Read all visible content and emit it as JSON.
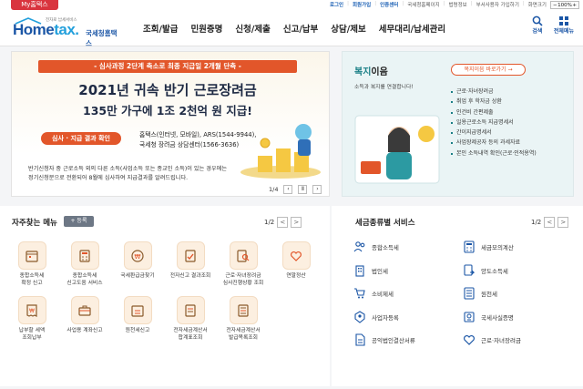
{
  "util": {
    "my_button": "My홈택스",
    "links": [
      "로그인",
      "회원가입",
      "인증센터",
      "국세청홈페이지",
      "법령정보",
      "부서사용자 가입하기",
      "화면크기"
    ],
    "zoom": "100%"
  },
  "header": {
    "logo_tag": "전자로 납세서비스",
    "logo_home": "Home",
    "logo_tax": "tax.",
    "logo_sub": "국세청홈택스",
    "menu": [
      "조회/발급",
      "민원증명",
      "신청/제출",
      "신고/납부",
      "상담/제보",
      "세무대리/납세관리"
    ],
    "search_label": "검색",
    "allmenu_label": "전체메뉴"
  },
  "banner": {
    "pill": "- 심사과정 2단계 축소로 최종 지급일 2개월 단축 -",
    "title": "2021년 귀속 반기 근로장려금",
    "title2": "135만 가구에 1조 2천억 원 지급!",
    "result_button": "심사 · 지급 결과 확인",
    "contact": [
      "홈택스(인터넷, 모바일), ARS(1544-9944),",
      "국세청 장려금 상담센터(1566-3636)"
    ],
    "notice": [
      "반기신청자 중 근로소득 외의 다른 소득(사업소득 또는 종교인 소득)이 있는 경우에는",
      "정기신청분으로 전환되어 8월에 심사하여 지급결과를 알려드립니다."
    ],
    "page": "1/4",
    "prev": "‹",
    "pause": "Ⅱ",
    "next": "›"
  },
  "welfare": {
    "title_accent": "복지",
    "title_rest": "이음",
    "desc": "소득과 복지를 연결합니다!",
    "button": "복지이음 바로가기",
    "arrow": "→",
    "items": [
      "근로·자녀장려금",
      "취업 후 학자금 상환",
      "인건비 간편제출",
      "일용근로소득 지급명세서",
      "간이지급명세서",
      "사업장제공자 등의 과세자료",
      "본인 소득내역 확인(근로·인적용역)"
    ]
  },
  "favorites": {
    "title": "자주찾는 메뉴",
    "register": "+ 등록",
    "page": "1/2",
    "prev": "<",
    "next": ">",
    "items": [
      {
        "label": "종합소득세\n확정 신고",
        "icon": "calendar-icon"
      },
      {
        "label": "종합소득세\n신고도움 서비스",
        "icon": "calculator-icon"
      },
      {
        "label": "국세환급금찾기",
        "icon": "won-coin-icon"
      },
      {
        "label": "전자신고 결과조회",
        "icon": "document-check-icon"
      },
      {
        "label": "근로·자녀장려금\n심사진행상황 조회",
        "icon": "document-search-icon"
      },
      {
        "label": "연말정산",
        "icon": "heart-hand-icon"
      },
      {
        "label": "납부할 세액\n조회납부",
        "icon": "receipt-icon"
      },
      {
        "label": "사업용 계좌신고",
        "icon": "briefcase-icon"
      },
      {
        "label": "원천세신고",
        "icon": "calendar-doc-icon"
      },
      {
        "label": "전자세금계산서\n합계표조회",
        "icon": "invoice-icon"
      },
      {
        "label": "전자세금계산서\n발급목록조회",
        "icon": "invoice-list-icon"
      }
    ]
  },
  "services": {
    "title": "세금종류별 서비스",
    "page": "1/2",
    "prev": "<",
    "next": ">",
    "items": [
      {
        "label": "종합소득세",
        "icon": "people-icon"
      },
      {
        "label": "세금모의계산",
        "icon": "calculator-icon"
      },
      {
        "label": "법인세",
        "icon": "building-icon"
      },
      {
        "label": "양도소득세",
        "icon": "transfer-doc-icon"
      },
      {
        "label": "소비제세",
        "icon": "cart-icon"
      },
      {
        "label": "원천세",
        "icon": "ledger-icon"
      },
      {
        "label": "사업자등록",
        "icon": "id-badge-icon"
      },
      {
        "label": "국세사실증명",
        "icon": "certificate-icon"
      },
      {
        "label": "공익법인결산서류",
        "icon": "file-icon"
      },
      {
        "label": "근로·자녀장려금",
        "icon": "heart-icon"
      }
    ]
  },
  "colors": {
    "brand": "#1b56a6",
    "accent": "#e2562a",
    "my_button": "#d9343e",
    "welfare_teal": "#1a7f86"
  }
}
